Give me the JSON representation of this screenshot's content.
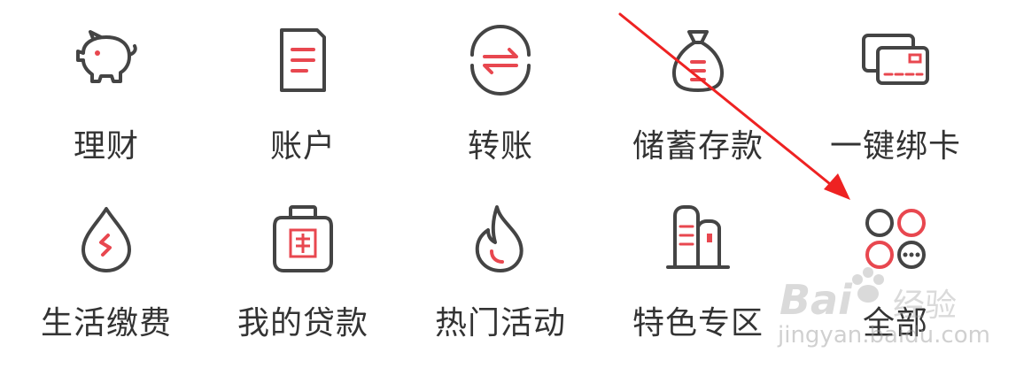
{
  "colors": {
    "icon_stroke": "#444444",
    "accent": "#e8474f",
    "label": "#333333",
    "arrow": "#ee2222",
    "background": "#ffffff"
  },
  "grid": {
    "items": [
      {
        "label": "理财",
        "icon": "piggy-bank-icon"
      },
      {
        "label": "账户",
        "icon": "document-icon"
      },
      {
        "label": "转账",
        "icon": "transfer-icon"
      },
      {
        "label": "储蓄存款",
        "icon": "money-bag-icon"
      },
      {
        "label": "一键绑卡",
        "icon": "bank-card-icon"
      },
      {
        "label": "生活缴费",
        "icon": "water-drop-icon"
      },
      {
        "label": "我的贷款",
        "icon": "loan-jar-icon"
      },
      {
        "label": "热门活动",
        "icon": "flame-icon"
      },
      {
        "label": "特色专区",
        "icon": "buildings-icon"
      },
      {
        "label": "全部",
        "icon": "all-apps-icon"
      }
    ]
  },
  "watermark": {
    "brand": "Bai",
    "brand_cn": "经验",
    "domain": "jingyan.baidu.com"
  }
}
